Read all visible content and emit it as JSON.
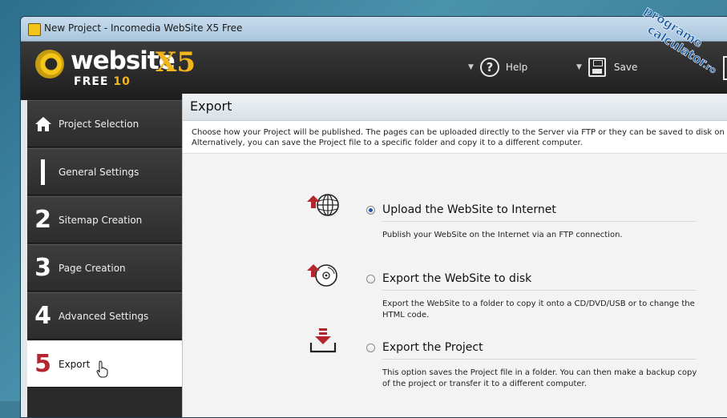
{
  "window": {
    "title": "New Project - Incomedia WebSite X5 Free"
  },
  "logo": {
    "name": "website",
    "version_mark": "X5",
    "edition": "FREE",
    "edition_number": "10"
  },
  "header": {
    "help_label": "Help",
    "save_label": "Save"
  },
  "sidebar": {
    "items": [
      {
        "marker": "",
        "label": "Project Selection",
        "icon": "home-icon"
      },
      {
        "marker": "",
        "label": "General Settings",
        "icon": "bar-icon"
      },
      {
        "marker": "2",
        "label": "Sitemap Creation"
      },
      {
        "marker": "3",
        "label": "Page Creation"
      },
      {
        "marker": "4",
        "label": "Advanced Settings"
      },
      {
        "marker": "5",
        "label": "Export",
        "active": true
      }
    ]
  },
  "panel": {
    "title": "Export",
    "description_line1": "Choose how your Project will be published. The pages can be uploaded directly to the Server via FTP or they can be saved to disk on your c",
    "description_line2": "Alternatively, you can save the Project file to a specific folder and copy it to a different computer."
  },
  "options": [
    {
      "label": "Upload the WebSite to Internet",
      "description": "Publish your WebSite on the Internet via an FTP connection.",
      "selected": true,
      "icon": "upload-globe-icon"
    },
    {
      "label": "Export the WebSite to disk",
      "description": "Export the WebSite to a folder to copy it onto a CD/DVD/USB or to change the HTML code.",
      "selected": false,
      "icon": "export-disk-icon"
    },
    {
      "label": "Export the Project",
      "description": "This option saves the Project file in a folder.  You can then make a backup copy of the project or transfer it to a different computer.",
      "selected": false,
      "icon": "export-project-icon"
    }
  ],
  "watermark": {
    "text_a": "programe",
    "text_b": "calculator",
    "text_c": ".ro"
  },
  "colors": {
    "accent_red": "#b3262d",
    "logo_yellow": "#f2b51a",
    "sidebar_dark": "#2c2c2c",
    "watermark_blue": "#1e5fa8"
  }
}
